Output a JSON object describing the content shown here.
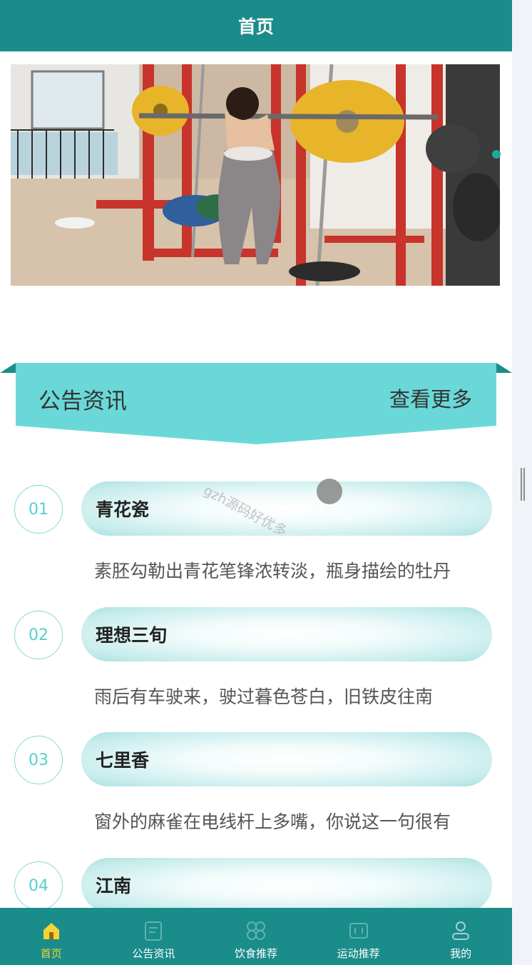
{
  "header": {
    "title": "首页"
  },
  "section": {
    "title": "公告资讯",
    "more": "查看更多"
  },
  "news": [
    {
      "num": "01",
      "title": "青花瓷",
      "desc": "素胚勾勒出青花笔锋浓转淡，瓶身描绘的牡丹"
    },
    {
      "num": "02",
      "title": "理想三旬",
      "desc": "雨后有车驶来，驶过暮色苍白，旧铁皮往南"
    },
    {
      "num": "03",
      "title": "七里香",
      "desc": "窗外的麻雀在电线杆上多嘴，你说这一句很有"
    },
    {
      "num": "04",
      "title": "江南",
      "desc": ""
    }
  ],
  "watermark": "gzh源码好优多",
  "tabs": [
    {
      "label": "首页",
      "icon": "home-icon"
    },
    {
      "label": "公告资讯",
      "icon": "notice-icon"
    },
    {
      "label": "饮食推荐",
      "icon": "food-icon"
    },
    {
      "label": "运动推荐",
      "icon": "sport-icon"
    },
    {
      "label": "我的",
      "icon": "user-icon"
    }
  ],
  "colors": {
    "primary": "#1a8c8a",
    "accent": "#6ad8d8",
    "active_tab": "#f6d23a"
  }
}
